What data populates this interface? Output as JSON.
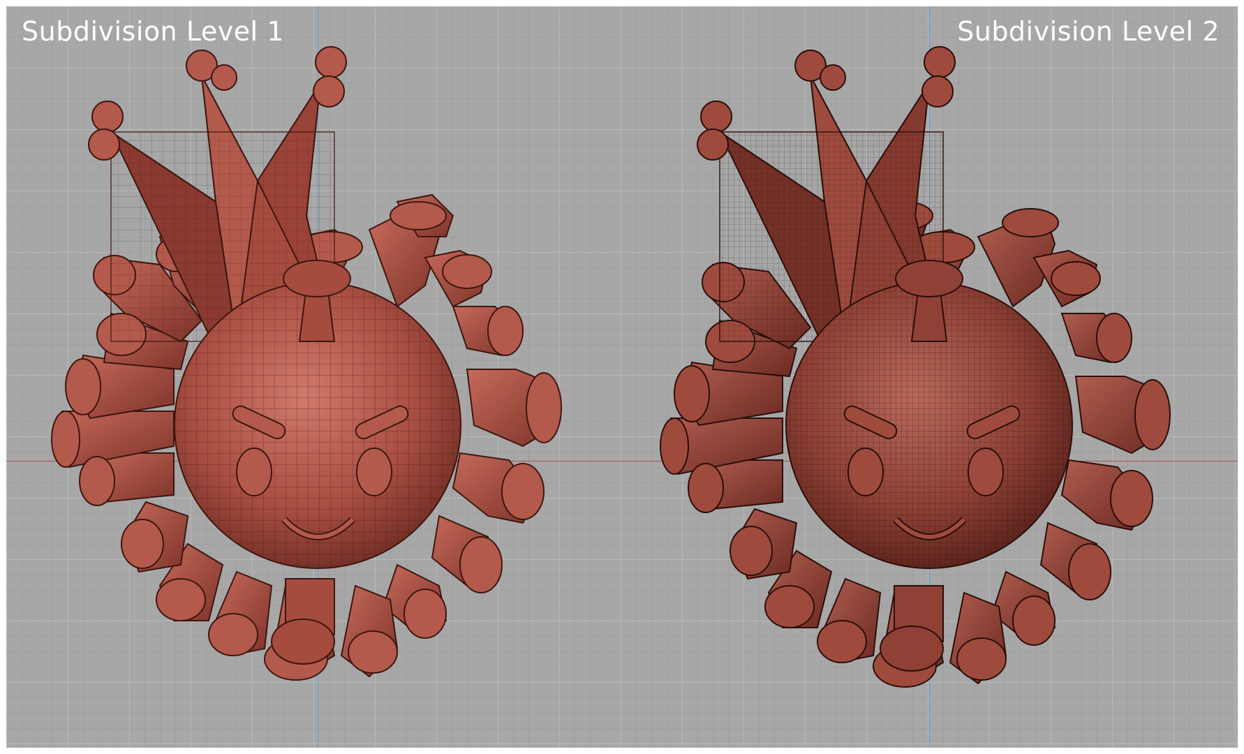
{
  "panels": [
    {
      "title": "Subdivision Level 1"
    },
    {
      "title": "Subdivision Level 2"
    }
  ],
  "colors": {
    "viewport_background": "#a7a7a7",
    "grid_minor": "#9f9f9f",
    "grid_major": "#b9b9b9",
    "model_base": "#b0574a",
    "model_dark": "#6b2a22",
    "axis_x": "#b05050",
    "axis_y": "#6a9cc7"
  },
  "icons": [
    "virus-crown-mesh-model-level-1",
    "virus-crown-mesh-model-level-2"
  ]
}
